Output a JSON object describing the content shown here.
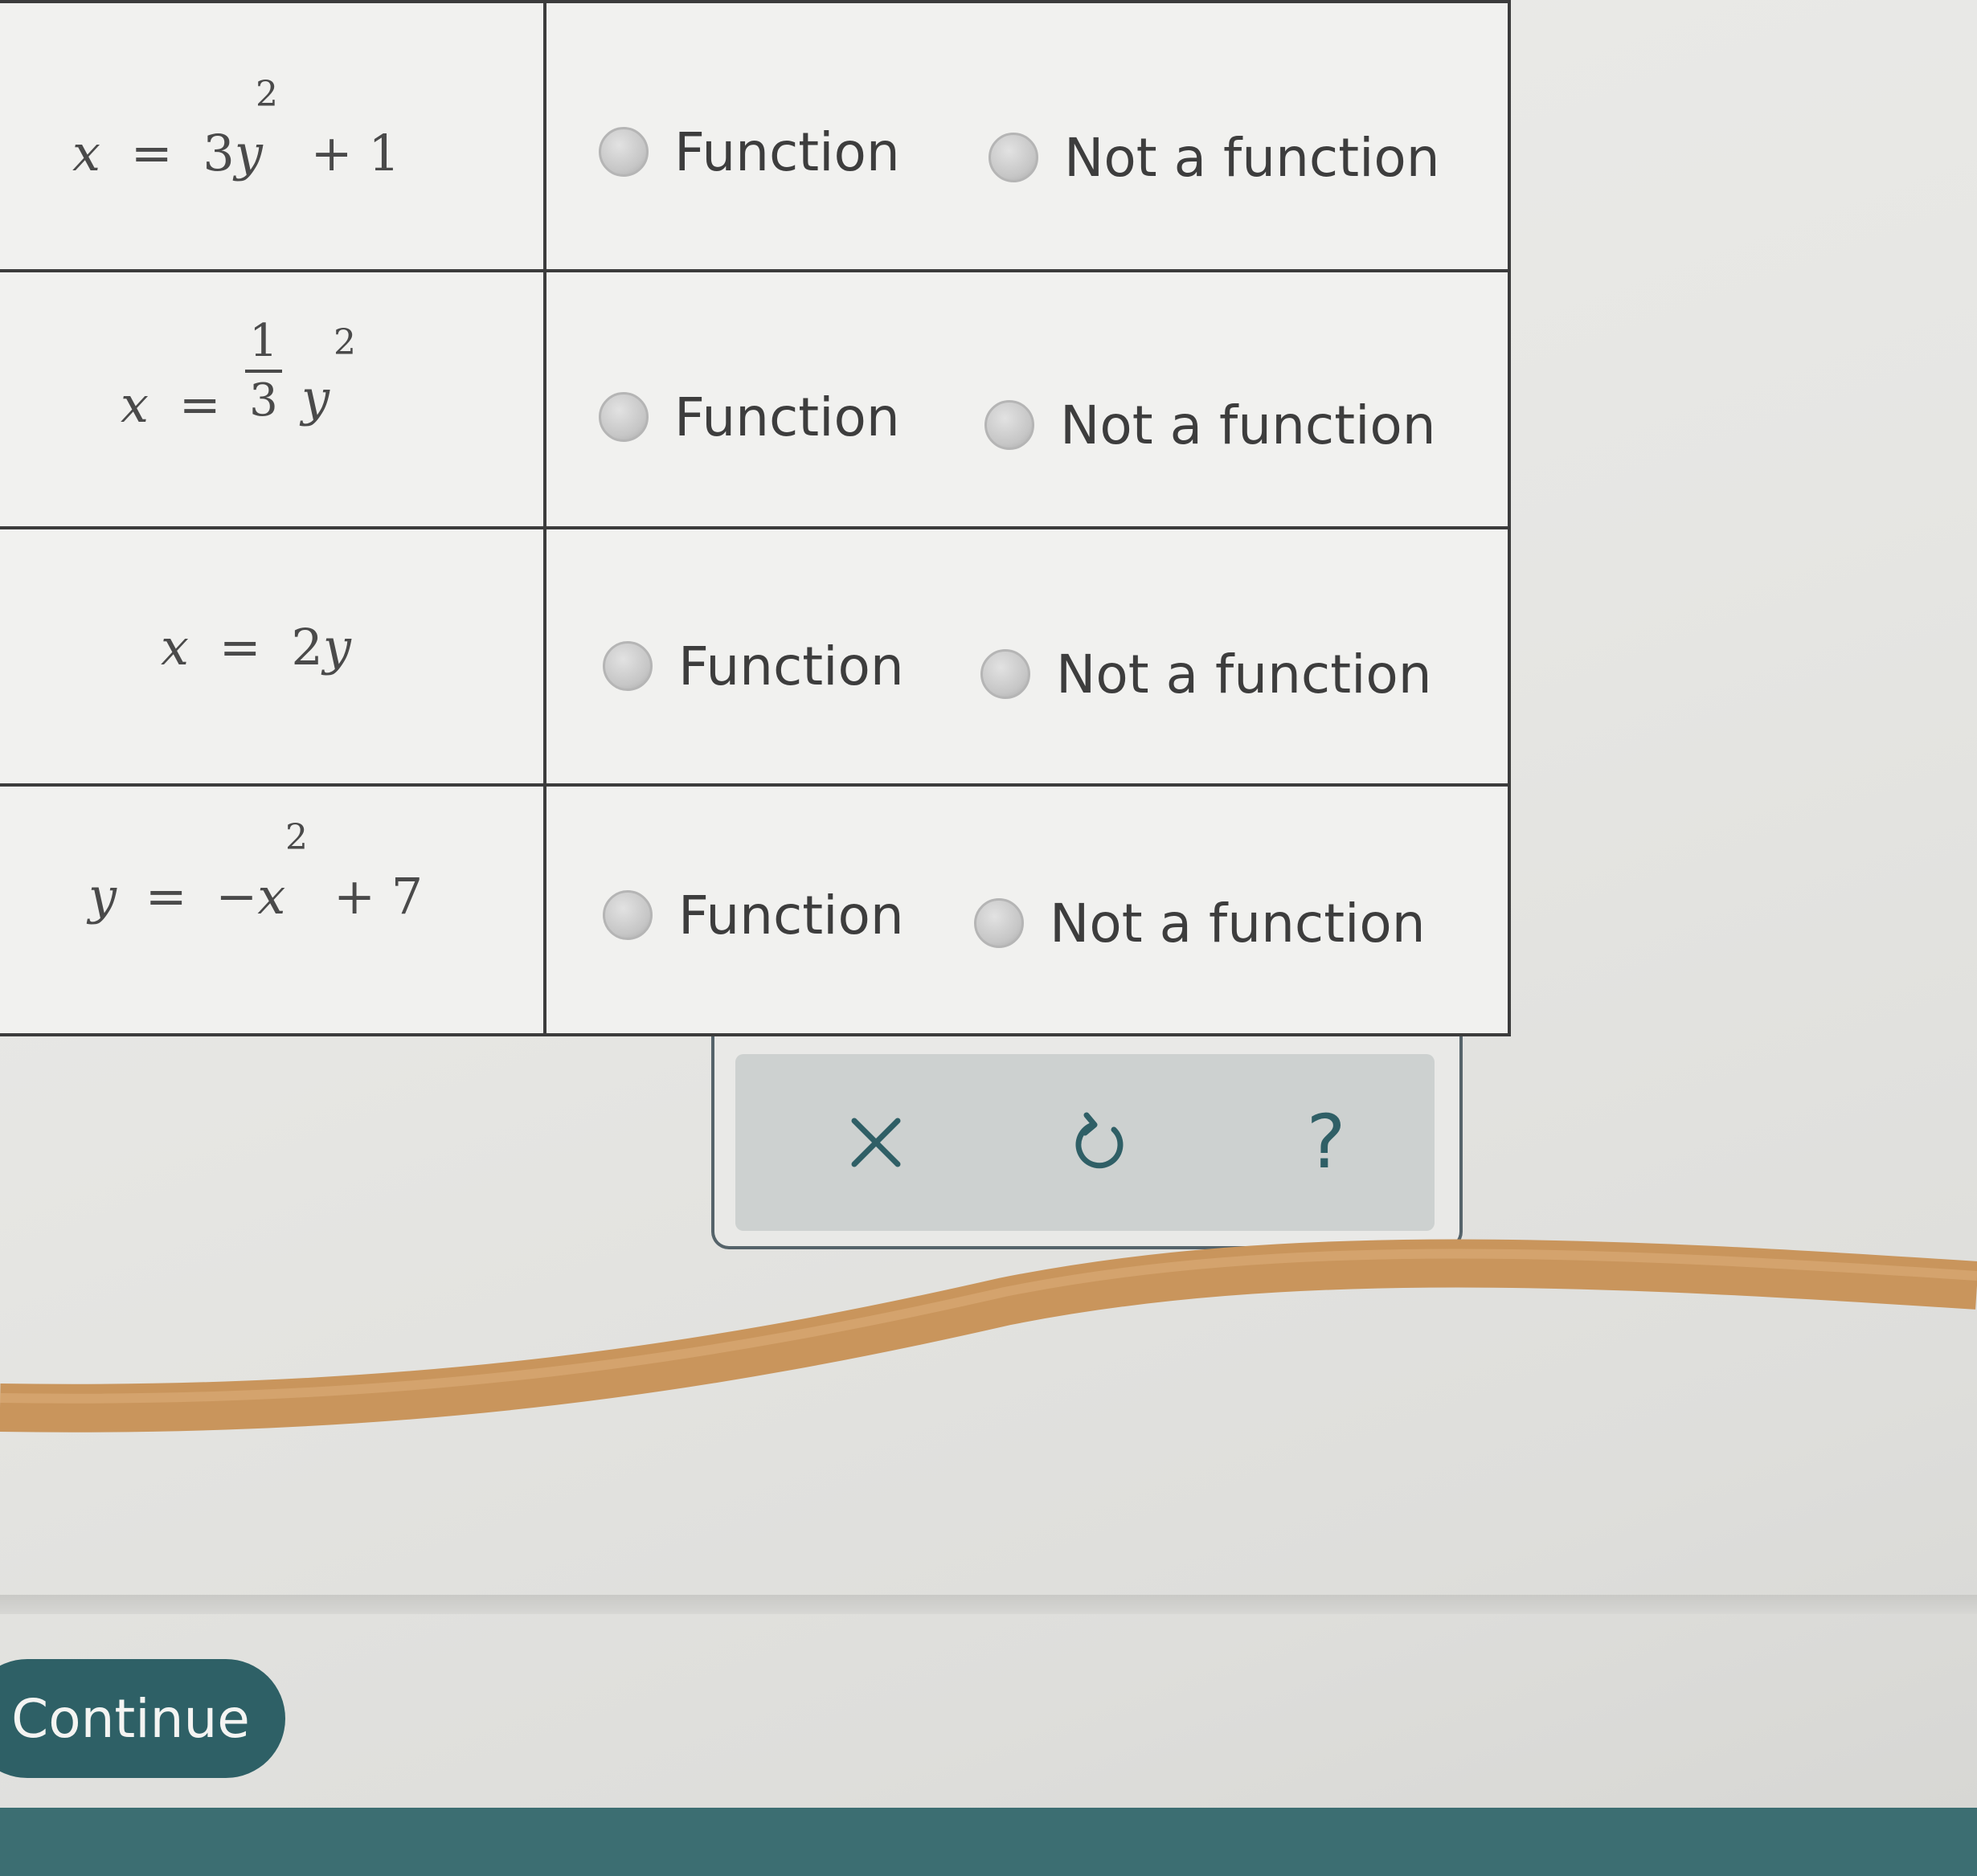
{
  "rows": [
    {
      "equation": {
        "lhs": "x",
        "eq": "=",
        "coef": "3",
        "var": "y",
        "exp": "2",
        "tail": "+ 1"
      },
      "options": {
        "function": "Function",
        "not_function": "Not a function"
      }
    },
    {
      "equation": {
        "lhs": "x",
        "eq": "=",
        "num": "1",
        "den": "3",
        "var": "y",
        "exp": "2"
      },
      "options": {
        "function": "Function",
        "not_function": "Not a function"
      }
    },
    {
      "equation": {
        "lhs": "x",
        "eq": "=",
        "coef": "2",
        "var": "y"
      },
      "options": {
        "function": "Function",
        "not_function": "Not a function"
      }
    },
    {
      "equation": {
        "lhs": "y",
        "eq": "=",
        "sign": "−",
        "var": "x",
        "exp": "2",
        "tail": "+ 7"
      },
      "options": {
        "function": "Function",
        "not_function": "Not a function"
      }
    }
  ],
  "toolbar": {
    "clear_icon": "close-icon",
    "undo_icon": "undo-icon",
    "help_icon": "question-icon",
    "help_glyph": "?"
  },
  "continue_label": "Continue",
  "colors": {
    "accent": "#2e6066",
    "icon": "#2f5f66",
    "cable": "#c9955c"
  }
}
